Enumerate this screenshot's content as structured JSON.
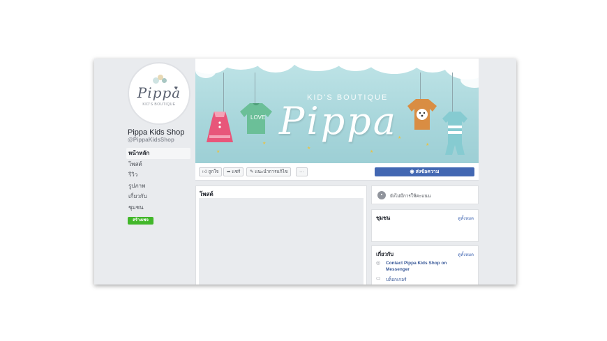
{
  "page": {
    "name": "Pippa Kids Shop",
    "handle": "@PippaKidsShop",
    "logo_word": "Pippa",
    "logo_sub": "KID'S BOUTIQUE",
    "cover_subtitle": "KID'S BOUTIQUE",
    "cover_title": "Pippa",
    "shirt_text": "LOVE"
  },
  "nav": {
    "items": [
      "หน้าหลัก",
      "โพสต์",
      "รีวิว",
      "รูปภาพ",
      "เกี่ยวกับ",
      "ชุมชน"
    ],
    "active_index": 0,
    "create_page_label": "สร้างเพจ"
  },
  "actions": {
    "like_label": "ถูกใจ",
    "share_label": "แชร์",
    "suggest_label": "แนะนำการแก้ไข",
    "more_label": "···",
    "message_label": "ส่งข้อความ"
  },
  "posts": {
    "title": "โพสต์"
  },
  "sidebar": {
    "response_text": "ยังไม่มีการให้คะแนน",
    "community_title": "ชุมชน",
    "community_link": "ดูทั้งหมด",
    "about_title": "เกี่ยวกับ",
    "about_link": "ดูทั้งหมด",
    "contact_line1": "Contact Pippa Kids Shop on",
    "contact_line2": "Messenger",
    "category": "บล็อกเกอร์"
  },
  "colors": {
    "facebook_blue": "#4267b2",
    "create_green": "#42b72a",
    "background": "#e9ebee",
    "cover_teal": "#a8d6db"
  }
}
